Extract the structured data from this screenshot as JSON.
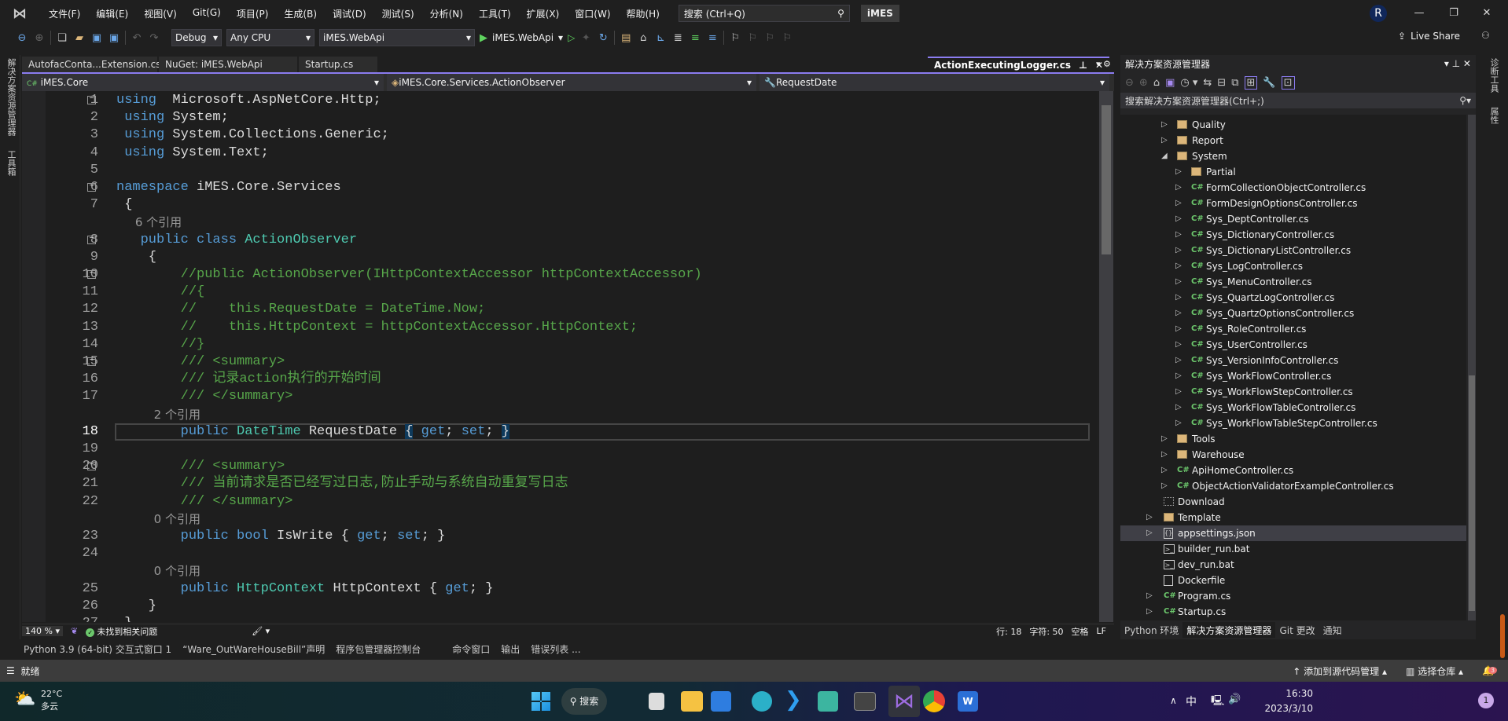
{
  "menubar": {
    "items": [
      "文件(F)",
      "编辑(E)",
      "视图(V)",
      "Git(G)",
      "项目(P)",
      "生成(B)",
      "调试(D)",
      "测试(S)",
      "分析(N)",
      "工具(T)",
      "扩展(X)",
      "窗口(W)",
      "帮助(H)"
    ],
    "search_placeholder": "搜索 (Ctrl+Q)",
    "solution_name": "iMES",
    "avatar": "R"
  },
  "toolbar": {
    "config": "Debug",
    "platform": "Any CPU",
    "startup_project": "iMES.WebApi",
    "run_label": "iMES.WebApi",
    "live_share": "Live Share"
  },
  "left_strip": [
    "解决方案资源管理器",
    "工具箱"
  ],
  "right_strip": [
    "诊断工具",
    "属性"
  ],
  "tabs": [
    "AutofacConta...Extension.cs",
    "NuGet: iMES.WebApi",
    "Startup.cs"
  ],
  "active_tab": "ActionExecutingLogger.cs",
  "navbar": {
    "project": "iMES.Core",
    "type": "iMES.Core.Services.ActionObserver",
    "member": "RequestDate"
  },
  "code_rows": [
    {
      "n": "1",
      "fold": true,
      "t": [
        [
          "kw",
          "using"
        ],
        [
          "",
          "  Microsoft.AspNetCore.Http;"
        ]
      ]
    },
    {
      "n": "2",
      "t": [
        [
          "kw",
          " using"
        ],
        [
          "",
          " System;"
        ]
      ]
    },
    {
      "n": "3",
      "t": [
        [
          "kw",
          " using"
        ],
        [
          "",
          " System.Collections.Generic;"
        ]
      ]
    },
    {
      "n": "4",
      "t": [
        [
          "kw",
          " using"
        ],
        [
          "",
          " System.Text;"
        ]
      ]
    },
    {
      "n": "5",
      "t": []
    },
    {
      "n": "6",
      "fold": true,
      "t": [
        [
          "kw",
          "namespace"
        ],
        [
          "",
          " iMES.Core.Services"
        ]
      ]
    },
    {
      "n": "7",
      "t": [
        [
          "",
          " {"
        ]
      ]
    },
    {
      "n": "",
      "t": [
        [
          "lens",
          "     6 个引用"
        ]
      ]
    },
    {
      "n": "8",
      "fold": true,
      "t": [
        [
          "kw",
          "   public class"
        ],
        [
          "",
          " "
        ],
        [
          "ty",
          "ActionObserver"
        ]
      ]
    },
    {
      "n": "9",
      "t": [
        [
          "",
          "    {"
        ]
      ]
    },
    {
      "n": "10",
      "fold": true,
      "t": [
        [
          "cm",
          "        //public ActionObserver(IHttpContextAccessor httpContextAccessor)"
        ]
      ]
    },
    {
      "n": "11",
      "t": [
        [
          "cm",
          "        //{"
        ]
      ]
    },
    {
      "n": "12",
      "t": [
        [
          "cm",
          "        //    this.RequestDate = DateTime.Now;"
        ]
      ]
    },
    {
      "n": "13",
      "t": [
        [
          "cm",
          "        //    this.HttpContext = httpContextAccessor.HttpContext;"
        ]
      ]
    },
    {
      "n": "14",
      "t": [
        [
          "cm",
          "        //}"
        ]
      ]
    },
    {
      "n": "15",
      "fold": true,
      "t": [
        [
          "cm",
          "        /// <summary>"
        ]
      ]
    },
    {
      "n": "16",
      "t": [
        [
          "cm",
          "        /// 记录action执行的开始时间"
        ]
      ]
    },
    {
      "n": "17",
      "t": [
        [
          "cm",
          "        /// </summary>"
        ]
      ]
    },
    {
      "n": "",
      "t": [
        [
          "lens",
          "          2 个引用"
        ]
      ]
    },
    {
      "n": "18",
      "current": true,
      "t": [
        [
          "kw",
          "        public"
        ],
        [
          "",
          " "
        ],
        [
          "ty",
          "DateTime"
        ],
        [
          "",
          " RequestDate "
        ],
        [
          "br",
          "{"
        ],
        [
          "kw",
          " get"
        ],
        [
          "",
          "; "
        ],
        [
          "kw",
          "set"
        ],
        [
          "",
          "; "
        ],
        [
          "br",
          "}"
        ]
      ]
    },
    {
      "n": "19",
      "t": []
    },
    {
      "n": "20",
      "fold": true,
      "t": [
        [
          "cm",
          "        /// <summary>"
        ]
      ]
    },
    {
      "n": "21",
      "t": [
        [
          "cm",
          "        /// 当前请求是否已经写过日志,防止手动与系统自动重复写日志"
        ]
      ]
    },
    {
      "n": "22",
      "t": [
        [
          "cm",
          "        /// </summary>"
        ]
      ]
    },
    {
      "n": "",
      "t": [
        [
          "lens",
          "          0 个引用"
        ]
      ]
    },
    {
      "n": "23",
      "t": [
        [
          "kw",
          "        public bool"
        ],
        [
          "",
          " IsWrite { "
        ],
        [
          "kw",
          "get"
        ],
        [
          "",
          "; "
        ],
        [
          "kw",
          "set"
        ],
        [
          "",
          "; }"
        ]
      ]
    },
    {
      "n": "24",
      "t": []
    },
    {
      "n": "",
      "t": [
        [
          "lens",
          "          0 个引用"
        ]
      ]
    },
    {
      "n": "25",
      "t": [
        [
          "kw",
          "        public"
        ],
        [
          "",
          " "
        ],
        [
          "ty",
          "HttpContext"
        ],
        [
          "",
          " HttpContext { "
        ],
        [
          "kw",
          "get"
        ],
        [
          "",
          "; }"
        ]
      ]
    },
    {
      "n": "26",
      "t": [
        [
          "",
          "    }"
        ]
      ]
    },
    {
      "n": "27",
      "t": [
        [
          "",
          " }"
        ]
      ]
    }
  ],
  "editor_status": {
    "zoom": "140 %",
    "issues": "未找到相关问题",
    "line": "行: 18",
    "char": "字符: 50",
    "indent": "空格",
    "eol": "LF"
  },
  "solution_explorer": {
    "title": "解决方案资源管理器",
    "search_placeholder": "搜索解决方案资源管理器(Ctrl+;)",
    "items": [
      {
        "label": "Quality",
        "level": 1,
        "icon": "folder",
        "arrow": "right"
      },
      {
        "label": "Report",
        "level": 1,
        "icon": "folder",
        "arrow": "right"
      },
      {
        "label": "System",
        "level": 1,
        "icon": "folder",
        "arrow": "down"
      },
      {
        "label": "Partial",
        "level": 2,
        "icon": "folder",
        "arrow": "right"
      },
      {
        "label": "FormCollectionObjectController.cs",
        "level": 2,
        "icon": "cs",
        "arrow": "right"
      },
      {
        "label": "FormDesignOptionsController.cs",
        "level": 2,
        "icon": "cs",
        "arrow": "right"
      },
      {
        "label": "Sys_DeptController.cs",
        "level": 2,
        "icon": "cs",
        "arrow": "right"
      },
      {
        "label": "Sys_DictionaryController.cs",
        "level": 2,
        "icon": "cs",
        "arrow": "right"
      },
      {
        "label": "Sys_DictionaryListController.cs",
        "level": 2,
        "icon": "cs",
        "arrow": "right"
      },
      {
        "label": "Sys_LogController.cs",
        "level": 2,
        "icon": "cs",
        "arrow": "right"
      },
      {
        "label": "Sys_MenuController.cs",
        "level": 2,
        "icon": "cs",
        "arrow": "right"
      },
      {
        "label": "Sys_QuartzLogController.cs",
        "level": 2,
        "icon": "cs",
        "arrow": "right"
      },
      {
        "label": "Sys_QuartzOptionsController.cs",
        "level": 2,
        "icon": "cs",
        "arrow": "right"
      },
      {
        "label": "Sys_RoleController.cs",
        "level": 2,
        "icon": "cs",
        "arrow": "right"
      },
      {
        "label": "Sys_UserController.cs",
        "level": 2,
        "icon": "cs",
        "arrow": "right"
      },
      {
        "label": "Sys_VersionInfoController.cs",
        "level": 2,
        "icon": "cs",
        "arrow": "right"
      },
      {
        "label": "Sys_WorkFlowController.cs",
        "level": 2,
        "icon": "cs",
        "arrow": "right"
      },
      {
        "label": "Sys_WorkFlowStepController.cs",
        "level": 2,
        "icon": "cs",
        "arrow": "right"
      },
      {
        "label": "Sys_WorkFlowTableController.cs",
        "level": 2,
        "icon": "cs",
        "arrow": "right"
      },
      {
        "label": "Sys_WorkFlowTableStepController.cs",
        "level": 2,
        "icon": "cs",
        "arrow": "right"
      },
      {
        "label": "Tools",
        "level": 1,
        "icon": "folder",
        "arrow": "right"
      },
      {
        "label": "Warehouse",
        "level": 1,
        "icon": "folder",
        "arrow": "right"
      },
      {
        "label": "ApiHomeController.cs",
        "level": 1,
        "icon": "cs",
        "arrow": "right"
      },
      {
        "label": "ObjectActionValidatorExampleController.cs",
        "level": 1,
        "icon": "cs",
        "arrow": "right"
      },
      {
        "label": "Download",
        "level": 0,
        "icon": "missing-folder",
        "arrow": ""
      },
      {
        "label": "Template",
        "level": 0,
        "icon": "folder",
        "arrow": "right"
      },
      {
        "label": "appsettings.json",
        "level": 0,
        "icon": "json",
        "arrow": "right",
        "selected": true
      },
      {
        "label": "builder_run.bat",
        "level": 0,
        "icon": "bat",
        "arrow": ""
      },
      {
        "label": "dev_run.bat",
        "level": 0,
        "icon": "bat",
        "arrow": ""
      },
      {
        "label": "Dockerfile",
        "level": 0,
        "icon": "file",
        "arrow": ""
      },
      {
        "label": "Program.cs",
        "level": 0,
        "icon": "cs",
        "arrow": "right"
      },
      {
        "label": "Startup.cs",
        "level": 0,
        "icon": "cs",
        "arrow": "right"
      }
    ],
    "bottom_tabs": [
      "Python 环境",
      "解决方案资源管理器",
      "Git 更改",
      "通知"
    ],
    "active_bottom_tab": "解决方案资源管理器"
  },
  "tool_tabs": [
    "Python 3.9 (64-bit) 交互式窗口 1",
    "“Ware_OutWareHouseBill”声明",
    "程序包管理器控制台",
    "命令窗口",
    "输出",
    "错误列表 ..."
  ],
  "statusbar": {
    "ready": "就绪",
    "source_control": "添加到源代码管理",
    "repo": "选择仓库",
    "notifications": "3"
  },
  "taskbar": {
    "weather_temp": "22°C",
    "weather_desc": "多云",
    "search": "搜索",
    "ime": "中",
    "time": "16:30",
    "date": "2023/3/10",
    "badge": "1"
  },
  "colors": {
    "accent": "#8b7cf0",
    "keyword": "#569cd6",
    "type": "#4ec9b0",
    "comment": "#57a64a",
    "editor_bg": "#1e1e1e"
  }
}
